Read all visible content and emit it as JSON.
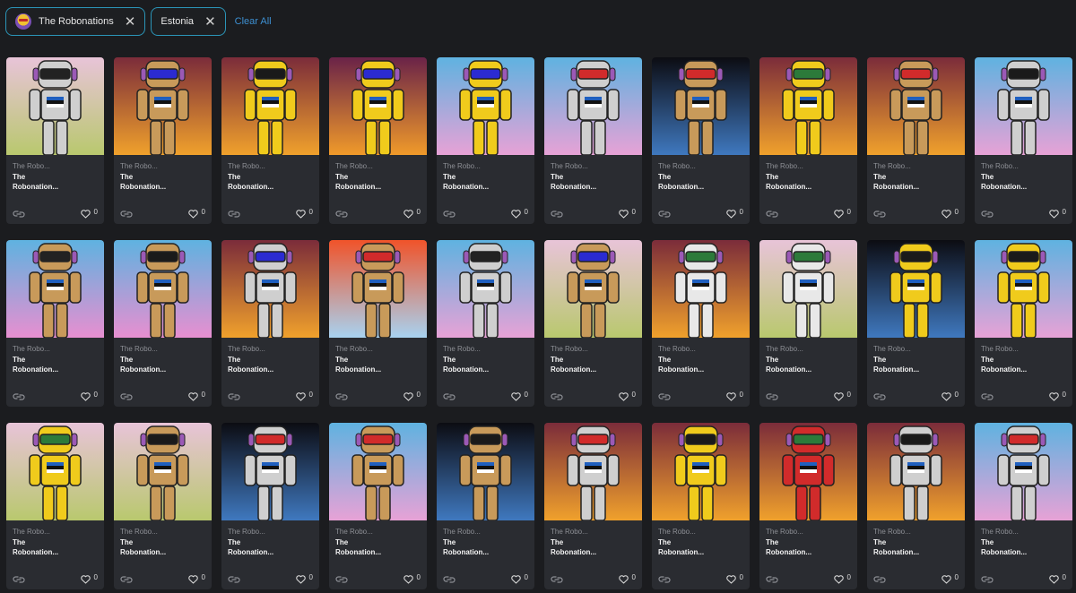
{
  "filters": [
    {
      "label": "The Robonations",
      "icon": "robot-avatar-icon"
    },
    {
      "label": "Estonia",
      "icon": ""
    }
  ],
  "clear_all_label": "Clear All",
  "icons": {
    "close": "close-icon",
    "link": "link-icon",
    "heart": "heart-icon"
  },
  "cards": [
    {
      "collection": "The Robo...",
      "name": "The\nRobonation...",
      "likes": "0",
      "bg": [
        "#e8c4d8",
        "#b9c86e"
      ],
      "body": "#cfcfcf",
      "visor": "#222222"
    },
    {
      "collection": "The Robo...",
      "name": "The\nRobonation...",
      "likes": "0",
      "bg": [
        "#7b2c3a",
        "#f0a12c"
      ],
      "body": "#c89a5a",
      "visor": "#2b2bd1"
    },
    {
      "collection": "The Robo...",
      "name": "The\nRobonation...",
      "likes": "0",
      "bg": [
        "#7b2c3a",
        "#f0a12c"
      ],
      "body": "#f0cb1c",
      "visor": "#1a1a1a"
    },
    {
      "collection": "The Robo...",
      "name": "The\nRobonation...",
      "likes": "0",
      "bg": [
        "#6a2348",
        "#f09a2a"
      ],
      "body": "#f0cb1c",
      "visor": "#2b2bd1"
    },
    {
      "collection": "The Robo...",
      "name": "The\nRobonation...",
      "likes": "0",
      "bg": [
        "#5fb2e0",
        "#e7a2d6"
      ],
      "body": "#f0cb1c",
      "visor": "#2b2bd1"
    },
    {
      "collection": "The Robo...",
      "name": "The\nRobonation...",
      "likes": "0",
      "bg": [
        "#5fb2e0",
        "#e7a2d6"
      ],
      "body": "#cfcfcf",
      "visor": "#d12b2b"
    },
    {
      "collection": "The Robo...",
      "name": "The\nRobonation...",
      "likes": "0",
      "bg": [
        "#0c0c12",
        "#3f78bf"
      ],
      "body": "#c89a5a",
      "visor": "#d12b2b"
    },
    {
      "collection": "The Robo...",
      "name": "The\nRobonation...",
      "likes": "0",
      "bg": [
        "#7b2c3a",
        "#f0a12c"
      ],
      "body": "#f0cb1c",
      "visor": "#2c7a3a"
    },
    {
      "collection": "The Robo...",
      "name": "The\nRobonation...",
      "likes": "0",
      "bg": [
        "#7b2c3a",
        "#f0a12c"
      ],
      "body": "#c89a5a",
      "visor": "#d12b2b"
    },
    {
      "collection": "The Robo...",
      "name": "The\nRobonation...",
      "likes": "0",
      "bg": [
        "#5fb2e0",
        "#e7a2d6"
      ],
      "body": "#cfcfcf",
      "visor": "#1a1a1a"
    },
    {
      "collection": "The Robo...",
      "name": "The\nRobonation...",
      "likes": "0",
      "bg": [
        "#5fb2e0",
        "#e78fd0"
      ],
      "body": "#c89a5a",
      "visor": "#222222"
    },
    {
      "collection": "The Robo...",
      "name": "The\nRobonation...",
      "likes": "0",
      "bg": [
        "#5fb2e0",
        "#e78fd0"
      ],
      "body": "#c89a5a",
      "visor": "#1a1a1a"
    },
    {
      "collection": "The Robo...",
      "name": "The\nRobonation...",
      "likes": "0",
      "bg": [
        "#7b2c3a",
        "#f0a12c"
      ],
      "body": "#cfcfcf",
      "visor": "#2b2bd1"
    },
    {
      "collection": "The Robo...",
      "name": "The\nRobonation...",
      "likes": "0",
      "bg": [
        "#f0532a",
        "#a8d2f0"
      ],
      "body": "#c89a5a",
      "visor": "#d12b2b"
    },
    {
      "collection": "The Robo...",
      "name": "The\nRobonation...",
      "likes": "0",
      "bg": [
        "#5fb2e0",
        "#e7a2d6"
      ],
      "body": "#cfcfcf",
      "visor": "#222222"
    },
    {
      "collection": "The Robo...",
      "name": "The\nRobonation...",
      "likes": "0",
      "bg": [
        "#e8c4d8",
        "#b9c86e"
      ],
      "body": "#c89a5a",
      "visor": "#2b2bd1"
    },
    {
      "collection": "The Robo...",
      "name": "The\nRobonation...",
      "likes": "0",
      "bg": [
        "#7b2c3a",
        "#f0a12c"
      ],
      "body": "#e8e8e8",
      "visor": "#2c7a3a"
    },
    {
      "collection": "The Robo...",
      "name": "The\nRobonation...",
      "likes": "0",
      "bg": [
        "#e8c4d8",
        "#b9c86e"
      ],
      "body": "#e8e8e8",
      "visor": "#2c7a3a"
    },
    {
      "collection": "The Robo...",
      "name": "The\nRobonation...",
      "likes": "0",
      "bg": [
        "#0c0c12",
        "#3f78bf"
      ],
      "body": "#f0cb1c",
      "visor": "#1a1a1a"
    },
    {
      "collection": "The Robo...",
      "name": "The\nRobonation...",
      "likes": "0",
      "bg": [
        "#5fb2e0",
        "#e7a2d6"
      ],
      "body": "#f0cb1c",
      "visor": "#1a1a1a"
    },
    {
      "collection": "The Robo...",
      "name": "The\nRobonation...",
      "likes": "0",
      "bg": [
        "#e8c4d8",
        "#b9c86e"
      ],
      "body": "#f0cb1c",
      "visor": "#2c7a3a"
    },
    {
      "collection": "The Robo...",
      "name": "The\nRobonation...",
      "likes": "0",
      "bg": [
        "#e8c4d8",
        "#b9c86e"
      ],
      "body": "#c89a5a",
      "visor": "#1a1a1a"
    },
    {
      "collection": "The Robo...",
      "name": "The\nRobonation...",
      "likes": "0",
      "bg": [
        "#0c0c12",
        "#3f78bf"
      ],
      "body": "#cfcfcf",
      "visor": "#d12b2b"
    },
    {
      "collection": "The Robo...",
      "name": "The\nRobonation...",
      "likes": "0",
      "bg": [
        "#5fb2e0",
        "#e7a2d6"
      ],
      "body": "#c89a5a",
      "visor": "#d12b2b"
    },
    {
      "collection": "The Robo...",
      "name": "The\nRobonation...",
      "likes": "0",
      "bg": [
        "#0c0c12",
        "#3f78bf"
      ],
      "body": "#c89a5a",
      "visor": "#1a1a1a"
    },
    {
      "collection": "The Robo...",
      "name": "The\nRobonation...",
      "likes": "0",
      "bg": [
        "#7b2c3a",
        "#f0a12c"
      ],
      "body": "#cfcfcf",
      "visor": "#d12b2b"
    },
    {
      "collection": "The Robo...",
      "name": "The\nRobonation...",
      "likes": "0",
      "bg": [
        "#7b2c3a",
        "#f0a12c"
      ],
      "body": "#f0cb1c",
      "visor": "#1a1a1a"
    },
    {
      "collection": "The Robo...",
      "name": "The\nRobonation...",
      "likes": "0",
      "bg": [
        "#7b2c3a",
        "#f0a12c"
      ],
      "body": "#d12b2b",
      "visor": "#2c7a3a"
    },
    {
      "collection": "The Robo...",
      "name": "The\nRobonation...",
      "likes": "0",
      "bg": [
        "#7b2c3a",
        "#f0a12c"
      ],
      "body": "#cfcfcf",
      "visor": "#1a1a1a"
    },
    {
      "collection": "The Robo...",
      "name": "The\nRobonation...",
      "likes": "0",
      "bg": [
        "#5fb2e0",
        "#e7a2d6"
      ],
      "body": "#cfcfcf",
      "visor": "#d12b2b"
    }
  ]
}
